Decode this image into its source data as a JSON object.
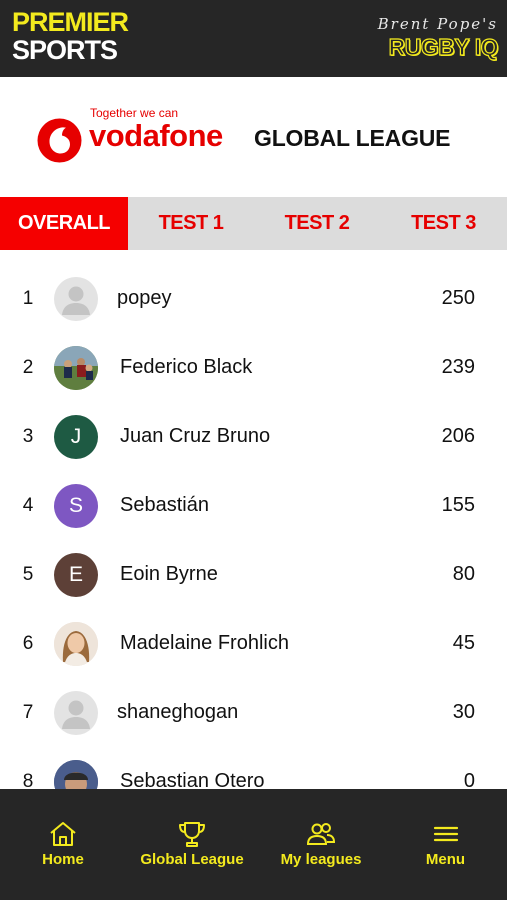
{
  "colors": {
    "header_bg": "#262626",
    "brand_yellow": "#f3ea1e",
    "vodafone_red": "#e60000",
    "active_tab": "#f50000",
    "tab_bg": "#dcdcdc"
  },
  "header": {
    "left_logo": {
      "line1": "PREMIER",
      "line2": "SPORTS"
    },
    "right_logo": {
      "script": "Brent Pope's",
      "title": "RUGBY IQ"
    }
  },
  "sponsor": {
    "tagline": "Together we can",
    "brand": "vodafone",
    "icon": "vodafone-speechmark-icon",
    "title": "GLOBAL LEAGUE"
  },
  "tabs": [
    {
      "label": "OVERALL",
      "active": true
    },
    {
      "label": "TEST 1",
      "active": false
    },
    {
      "label": "TEST 2",
      "active": false
    },
    {
      "label": "TEST 3",
      "active": false
    }
  ],
  "leaderboard": [
    {
      "rank": "1",
      "name": "popey",
      "score": "250",
      "avatar": {
        "type": "placeholder",
        "icon": "default-user-icon"
      }
    },
    {
      "rank": "2",
      "name": "Federico Black",
      "score": "239",
      "avatar": {
        "type": "photo",
        "icon": "rugby-photo-avatar"
      }
    },
    {
      "rank": "3",
      "name": "Juan Cruz Bruno",
      "score": "206",
      "avatar": {
        "type": "initial",
        "initial": "J",
        "color": "#1e5a43"
      }
    },
    {
      "rank": "4",
      "name": "Sebastián",
      "score": "155",
      "avatar": {
        "type": "initial",
        "initial": "S",
        "color": "#7e57c2"
      }
    },
    {
      "rank": "5",
      "name": "Eoin Byrne",
      "score": "80",
      "avatar": {
        "type": "initial",
        "initial": "E",
        "color": "#5d4037"
      }
    },
    {
      "rank": "6",
      "name": "Madelaine Frohlich",
      "score": "45",
      "avatar": {
        "type": "photo",
        "icon": "portrait-photo-avatar"
      }
    },
    {
      "rank": "7",
      "name": "shaneghogan",
      "score": "30",
      "avatar": {
        "type": "placeholder",
        "icon": "default-user-icon"
      }
    },
    {
      "rank": "8",
      "name": "Sebastian Otero",
      "score": "0",
      "avatar": {
        "type": "photo",
        "icon": "photo-avatar"
      }
    }
  ],
  "bottom_nav": [
    {
      "label": "Home",
      "icon": "home-icon"
    },
    {
      "label": "Global League",
      "icon": "trophy-icon"
    },
    {
      "label": "My leagues",
      "icon": "users-icon"
    },
    {
      "label": "Menu",
      "icon": "menu-icon"
    }
  ]
}
